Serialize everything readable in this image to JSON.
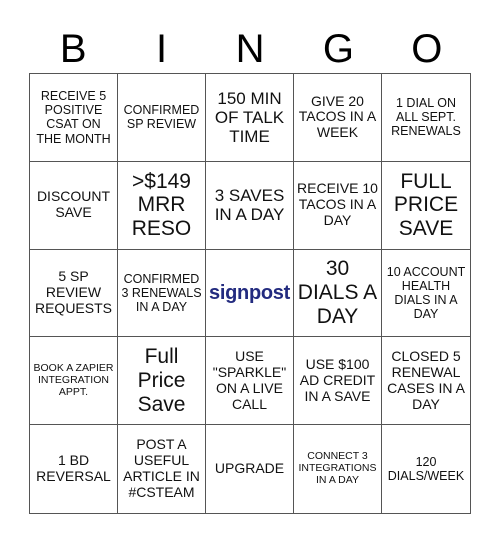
{
  "header": {
    "letters": [
      "B",
      "I",
      "N",
      "G",
      "O"
    ]
  },
  "accent_color": "#232b7f",
  "cells": [
    {
      "text": "RECEIVE 5 POSITIVE CSAT ON THE MONTH",
      "size": "s"
    },
    {
      "text": "CONFIRMED SP REVIEW",
      "size": "s"
    },
    {
      "text": "150 MIN OF TALK TIME",
      "size": "l"
    },
    {
      "text": "GIVE 20 TACOS IN A WEEK",
      "size": "m"
    },
    {
      "text": "1 DIAL ON ALL SEPT. RENEWALS",
      "size": "s"
    },
    {
      "text": "DISCOUNT SAVE",
      "size": "m"
    },
    {
      "text": ">$149 MRR RESO",
      "size": "xl"
    },
    {
      "text": "3 SAVES IN A DAY",
      "size": "l"
    },
    {
      "text": "RECEIVE 10 TACOS IN A DAY",
      "size": "m"
    },
    {
      "text": "FULL PRICE SAVE",
      "size": "xl"
    },
    {
      "text": "5 SP REVIEW REQUESTS",
      "size": "m"
    },
    {
      "text": "CONFIRMED 3 RENEWALS IN A DAY",
      "size": "s"
    },
    {
      "text": "signpost",
      "size": "free",
      "free": true
    },
    {
      "text": "30 DIALS A DAY",
      "size": "xl"
    },
    {
      "text": "10 ACCOUNT HEALTH DIALS IN A DAY",
      "size": "s"
    },
    {
      "text": "BOOK A ZAPIER INTEGRATION APPT.",
      "size": "xs"
    },
    {
      "text": "Full Price Save",
      "size": "xl"
    },
    {
      "text": "USE \"SPARKLE\" ON A LIVE CALL",
      "size": "m"
    },
    {
      "text": "USE $100 AD CREDIT IN A SAVE",
      "size": "m"
    },
    {
      "text": "CLOSED 5 RENEWAL CASES IN A DAY",
      "size": "m"
    },
    {
      "text": "1 BD REVERSAL",
      "size": "m"
    },
    {
      "text": "POST A USEFUL ARTICLE IN #CSTEAM",
      "size": "m"
    },
    {
      "text": "UPGRADE",
      "size": "m"
    },
    {
      "text": "CONNECT 3 INTEGRATIONS IN A DAY",
      "size": "xs"
    },
    {
      "text": "120 DIALS/WEEK",
      "size": "s"
    }
  ]
}
